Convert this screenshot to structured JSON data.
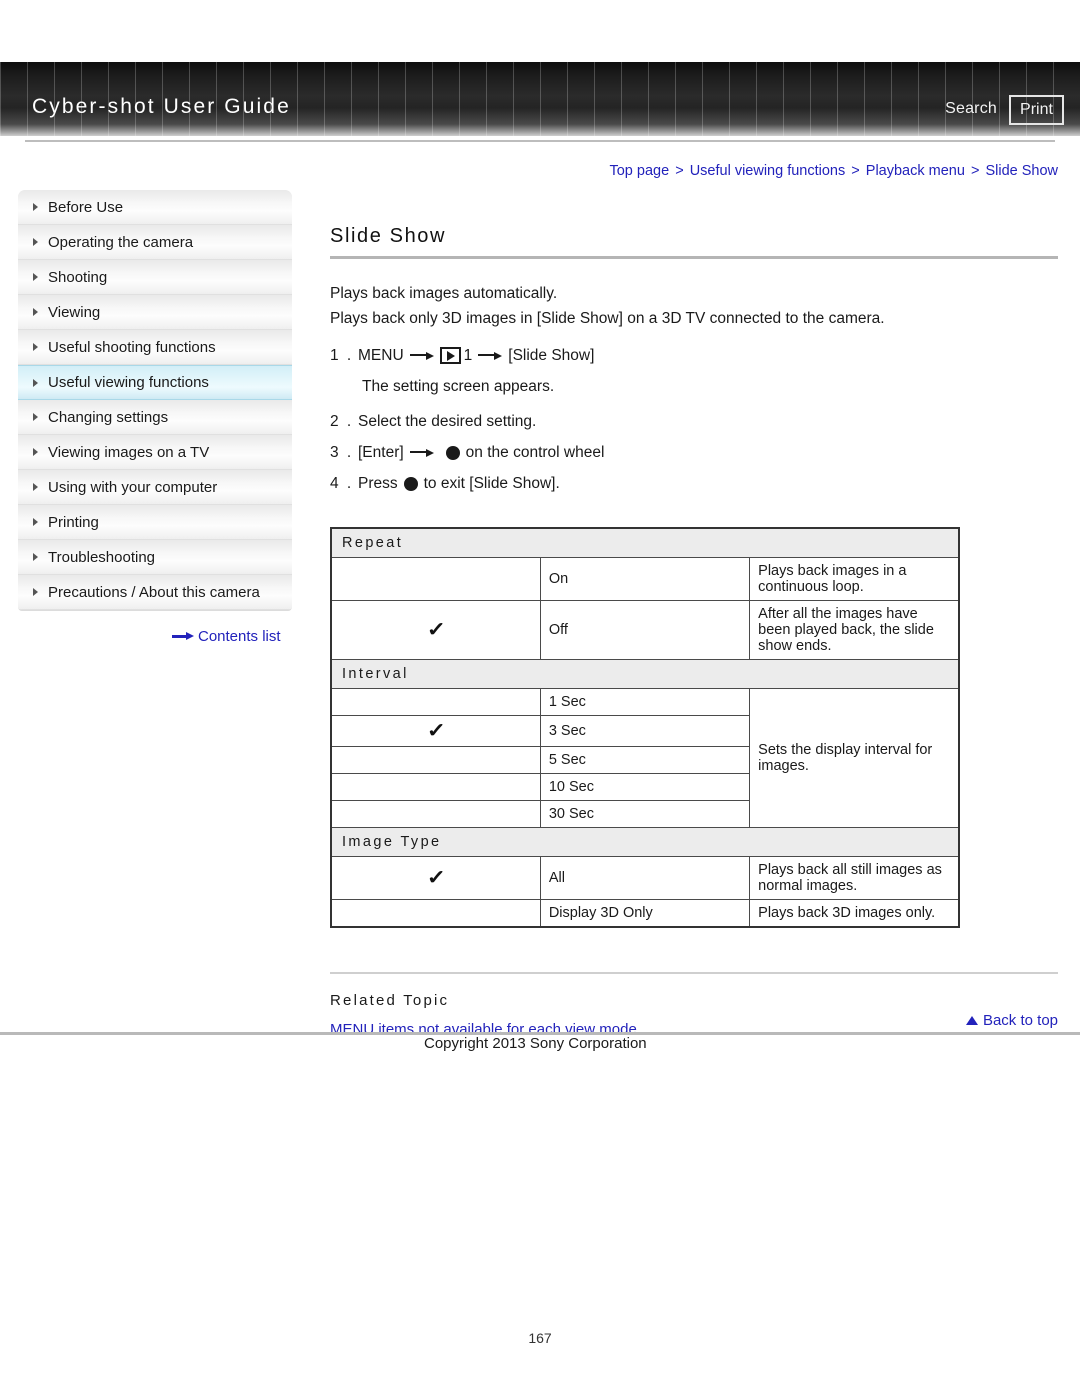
{
  "header": {
    "brand_title": "Cyber-shot User Guide",
    "search_label": "Search",
    "print_label": "Print"
  },
  "breadcrumb": {
    "items": [
      "Top page",
      "Useful viewing functions",
      "Playback menu",
      "Slide Show"
    ],
    "separator": ">"
  },
  "sidebar": {
    "items": [
      {
        "label": "Before Use",
        "active": false
      },
      {
        "label": "Operating the camera",
        "active": false
      },
      {
        "label": "Shooting",
        "active": false
      },
      {
        "label": "Viewing",
        "active": false
      },
      {
        "label": "Useful shooting functions",
        "active": false
      },
      {
        "label": "Useful viewing functions",
        "active": true
      },
      {
        "label": "Changing settings",
        "active": false
      },
      {
        "label": "Viewing images on a TV",
        "active": false
      },
      {
        "label": "Using with your computer",
        "active": false
      },
      {
        "label": "Printing",
        "active": false
      },
      {
        "label": "Troubleshooting",
        "active": false
      },
      {
        "label": "Precautions / About this camera",
        "active": false
      }
    ],
    "contents_list_label": "Contents list"
  },
  "main": {
    "page_title": "Slide Show",
    "intro_line_1": "Plays back images automatically.",
    "intro_line_2": "Plays back only 3D images in [Slide Show] on a 3D TV connected to the camera.",
    "steps": {
      "step1_num": "1 .",
      "step1_menu": "MENU",
      "step1_tab": "1",
      "step1_target": "[Slide Show]",
      "step1_note": "The setting screen appears.",
      "step2_num": "2 .",
      "step2_text": "Select the desired setting.",
      "step3_num": "3 .",
      "step3_enter": "[Enter]",
      "step3_tail": "on the control wheel",
      "step4_num": "4 .",
      "step4_lead": "Press",
      "step4_tail": "to exit [Slide Show]."
    }
  },
  "table": {
    "sections": [
      {
        "title": "Repeat",
        "rows": [
          {
            "checked": false,
            "option": "On",
            "description": "Plays back images in a continuous loop."
          },
          {
            "checked": true,
            "option": "Off",
            "description": "After all the images have been played back, the slide show ends."
          }
        ]
      },
      {
        "title": "Interval",
        "merged_description": "Sets the display interval for images.",
        "rows": [
          {
            "checked": false,
            "option": "1 Sec"
          },
          {
            "checked": true,
            "option": "3 Sec"
          },
          {
            "checked": false,
            "option": "5 Sec"
          },
          {
            "checked": false,
            "option": "10 Sec"
          },
          {
            "checked": false,
            "option": "30 Sec"
          }
        ]
      },
      {
        "title": "Image Type",
        "rows": [
          {
            "checked": true,
            "option": "All",
            "description": "Plays back all still images as normal images."
          },
          {
            "checked": false,
            "option": "Display 3D Only",
            "description": "Plays back 3D images only."
          }
        ]
      }
    ],
    "check_glyph": "✓"
  },
  "related": {
    "heading": "Related Topic",
    "link": "MENU items not available for each view mode"
  },
  "footer": {
    "back_to_top": "Back to top",
    "copyright": "Copyright 2013 Sony Corporation",
    "page_number": "167"
  },
  "colors": {
    "link": "#2222bb",
    "header_bg": "#1c1c1c",
    "active_nav": "#d2eef7",
    "section_head_bg": "#ececec"
  }
}
